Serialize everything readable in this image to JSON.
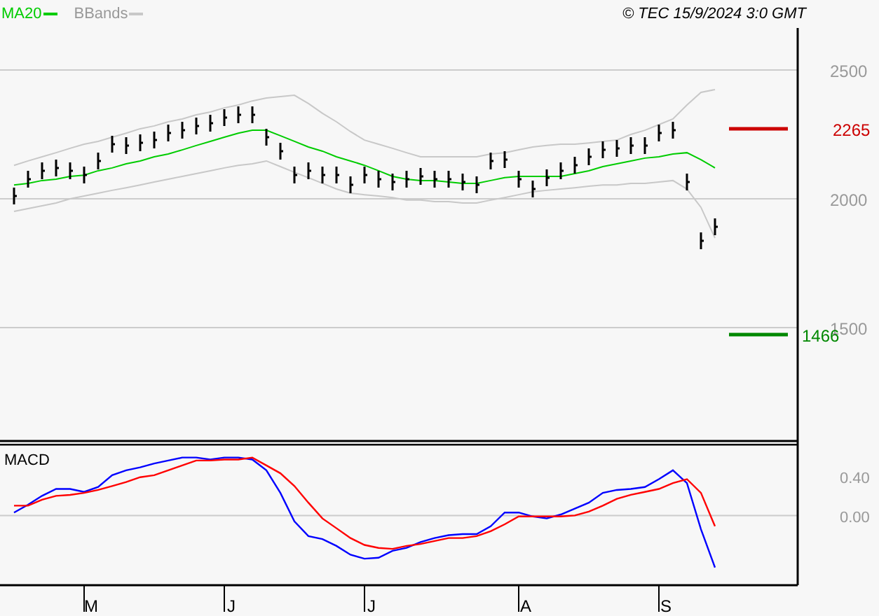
{
  "copyright": "© TEC 15/9/2024 3:0 GMT",
  "price_panel": {
    "chart_data": {
      "type": "line",
      "grid": true,
      "categories": [
        null,
        null,
        null,
        null,
        null,
        null,
        null,
        null,
        null,
        null,
        null,
        null,
        null,
        null,
        null,
        null,
        null,
        null,
        null,
        null,
        null,
        null,
        null,
        null,
        null,
        null,
        null,
        null,
        null,
        null,
        null,
        null,
        null,
        null,
        null,
        null,
        null,
        null,
        null,
        null,
        null,
        null,
        null,
        null,
        null,
        null,
        null,
        null,
        null,
        null,
        null
      ],
      "ylim": [
        1060,
        2663
      ],
      "yticks": [
        2500,
        2000,
        1500
      ],
      "series": [
        {
          "name": "MA20",
          "color": "#00cc00",
          "values": [
            2054,
            2060,
            2071,
            2076,
            2087,
            2092,
            2109,
            2120,
            2136,
            2147,
            2163,
            2174,
            2190,
            2207,
            2223,
            2239,
            2255,
            2266,
            2266,
            2245,
            2223,
            2201,
            2185,
            2163,
            2147,
            2130,
            2109,
            2087,
            2076,
            2071,
            2071,
            2065,
            2060,
            2060,
            2071,
            2082,
            2087,
            2087,
            2087,
            2087,
            2098,
            2109,
            2125,
            2136,
            2147,
            2158,
            2163,
            2174,
            2179,
            2152,
            2120
          ]
        },
        {
          "name": "BBands",
          "color": "#c8c8c8",
          "values": [
            2130,
            2147,
            2163,
            2179,
            2196,
            2212,
            2223,
            2239,
            2255,
            2272,
            2283,
            2299,
            2310,
            2326,
            2337,
            2353,
            2364,
            2380,
            2391,
            2397,
            2402,
            2370,
            2332,
            2299,
            2261,
            2228,
            2212,
            2196,
            2179,
            2163,
            2163,
            2163,
            2163,
            2163,
            2174,
            2179,
            2190,
            2201,
            2207,
            2212,
            2212,
            2217,
            2223,
            2228,
            2250,
            2266,
            2288,
            2310,
            2364,
            2413,
            2424
          ]
        },
        {
          "color": "#c8c8c8",
          "values": [
            1951,
            1962,
            1973,
            1984,
            2000,
            2011,
            2022,
            2033,
            2043,
            2054,
            2065,
            2076,
            2087,
            2098,
            2109,
            2120,
            2130,
            2136,
            2147,
            2125,
            2103,
            2082,
            2060,
            2038,
            2022,
            2016,
            2011,
            2005,
            1995,
            1995,
            1989,
            1989,
            1984,
            1984,
            1995,
            2005,
            2016,
            2027,
            2033,
            2038,
            2043,
            2049,
            2054,
            2054,
            2060,
            2060,
            2065,
            2071,
            2038,
            1967,
            1848
          ]
        }
      ]
    },
    "levels": [
      {
        "label": "2265",
        "color": "#cc0000"
      },
      {
        "label": "1466",
        "color": "#008800"
      }
    ]
  },
  "macd_panel": {
    "chart_data": {
      "type": "line",
      "title": "MACD",
      "grid": true,
      "categories": [
        null,
        null,
        null,
        null,
        null,
        "M",
        null,
        null,
        null,
        null,
        null,
        null,
        null,
        null,
        null,
        "J",
        null,
        null,
        null,
        null,
        null,
        null,
        null,
        null,
        null,
        "J",
        null,
        null,
        null,
        null,
        null,
        null,
        null,
        null,
        null,
        null,
        "A",
        null,
        null,
        null,
        null,
        null,
        null,
        null,
        null,
        null,
        "S",
        null,
        null,
        null,
        null
      ],
      "ylim": [
        -0.71,
        0.73
      ],
      "yticks": [
        {
          "value": 0.4,
          "label": "0.40"
        },
        {
          "value": 0,
          "label": "0.00"
        }
      ],
      "series": [
        {
          "color": "#0000ff",
          "values": [
            0.03,
            0.11,
            0.2,
            0.27,
            0.27,
            0.24,
            0.29,
            0.41,
            0.46,
            0.49,
            0.53,
            0.56,
            0.59,
            0.59,
            0.57,
            0.59,
            0.59,
            0.57,
            0.46,
            0.23,
            -0.06,
            -0.21,
            -0.24,
            -0.31,
            -0.4,
            -0.44,
            -0.43,
            -0.36,
            -0.33,
            -0.27,
            -0.23,
            -0.2,
            -0.19,
            -0.19,
            -0.11,
            0.03,
            0.03,
            -0.01,
            -0.03,
            0.01,
            0.07,
            0.13,
            0.23,
            0.26,
            0.27,
            0.29,
            0.37,
            0.46,
            0.33,
            -0.14,
            -0.53
          ]
        },
        {
          "color": "#ff0000",
          "values": [
            0.1,
            0.1,
            0.16,
            0.2,
            0.21,
            0.23,
            0.26,
            0.3,
            0.34,
            0.39,
            0.41,
            0.46,
            0.51,
            0.56,
            0.56,
            0.57,
            0.57,
            0.59,
            0.51,
            0.43,
            0.3,
            0.13,
            -0.03,
            -0.13,
            -0.23,
            -0.3,
            -0.33,
            -0.34,
            -0.31,
            -0.29,
            -0.26,
            -0.23,
            -0.23,
            -0.21,
            -0.16,
            -0.09,
            -0.01,
            -0.01,
            -0.01,
            -0.01,
            0,
            0.04,
            0.1,
            0.17,
            0.21,
            0.24,
            0.27,
            0.33,
            0.37,
            0.23,
            -0.11
          ]
        }
      ]
    }
  }
}
